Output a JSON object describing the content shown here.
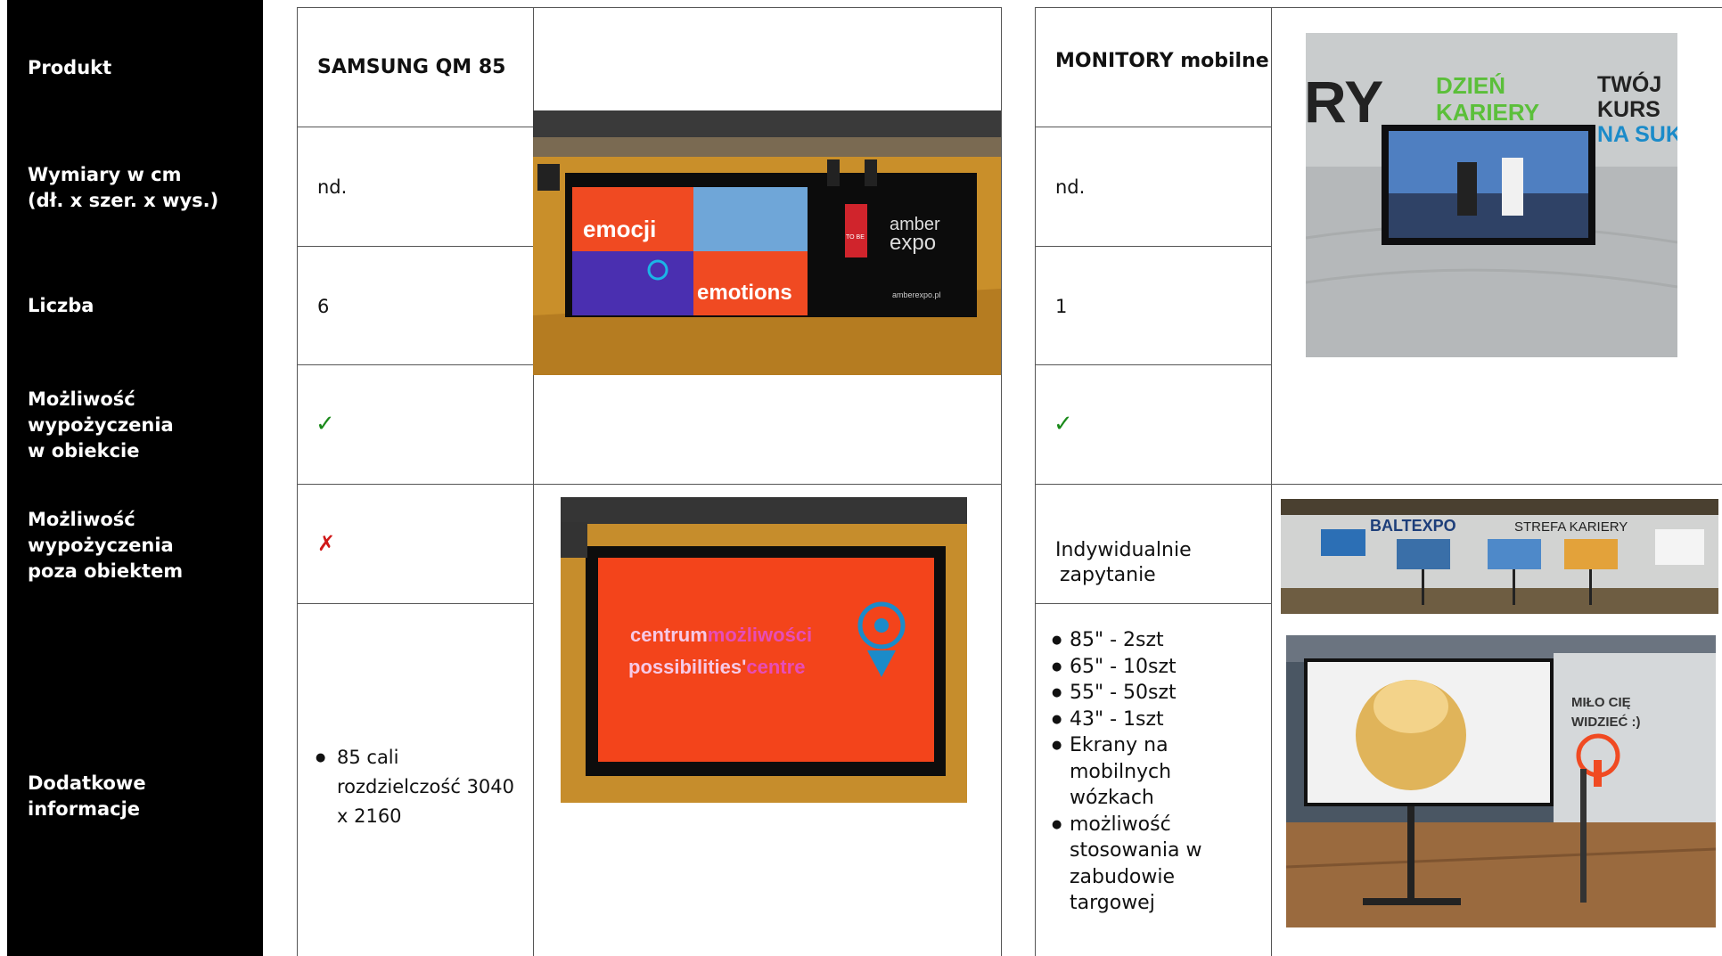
{
  "row_labels": {
    "produkt": "Produkt",
    "wymiary_1": "Wymiary w cm",
    "wymiary_2": "(dł. x szer. x wys.)",
    "liczba": "Liczba",
    "wewn_1": "Możliwość",
    "wewn_2": "wypożyczenia",
    "wewn_3": "w obiekcie",
    "zewn_1": "Możliwość",
    "zewn_2": "wypożyczenia",
    "zewn_3": "poza obiektem",
    "dodatkowe": "Dodatkowe informacje"
  },
  "products": [
    {
      "name": "SAMSUNG QM 85",
      "dimensions": "nd.",
      "count": "6",
      "in_venue": "✓",
      "outside_venue": "✗",
      "info": [
        "85 cali",
        "rozdzielczość 3040",
        "x 2160"
      ],
      "photo1_texts": {
        "emocji": "emocji",
        "emotions": "emotions",
        "tobe": "TO BE",
        "amber": "amber",
        "expo": "expo",
        "site": "amberexpo.pl"
      },
      "photo2_texts": {
        "centrum": "centrum",
        "mozliwosci": "możliwości",
        "possibilities": "possibilities'",
        "centre": "centre"
      }
    },
    {
      "name": "MONITORY mobilne",
      "dimensions": "nd.",
      "count": "1",
      "in_venue": "✓",
      "outside_venue_1": "Indywidualnie",
      "outside_venue_2": "zapytanie",
      "info": [
        "85\" - 2szt",
        "65\" - 10szt",
        "55\" - 50szt",
        "43\" - 1szt",
        "Ekrany na mobilnych wózkach",
        "możliwość stosowania w zabudowie targowej"
      ],
      "photo1_texts": {
        "ry": "RY",
        "dzien": "DZIEŃ",
        "kariery": "KARIERY",
        "twoj": "TWÓJ",
        "kurs": "KURS",
        "nasuk": "NA SUK"
      },
      "photo2_texts": {
        "baltexpo": "BALTEXPO",
        "strefa": "STREFA  KARIERY"
      },
      "photo3_texts": {
        "milo": "MIŁO CIĘ",
        "widziec": "WIDZIEĆ :)"
      }
    }
  ],
  "colors": {
    "sidebar": "#000000",
    "accent_orange": "#f04a22",
    "check_green": "#1b8a1b",
    "cross_red": "#d01818",
    "brand_green": "#5bbf3a",
    "brand_blue": "#1b8bc9"
  }
}
